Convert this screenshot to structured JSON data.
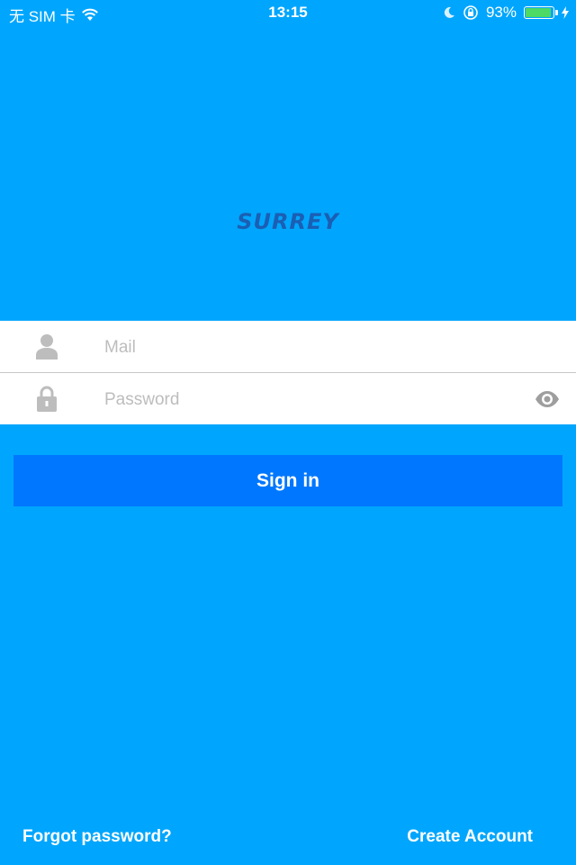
{
  "status_bar": {
    "carrier": "无 SIM 卡",
    "time": "13:15",
    "battery_percent": "93%",
    "battery_level": 0.93,
    "icons": [
      "wifi-icon",
      "moon-icon",
      "orientation-lock-icon",
      "battery-icon",
      "charging-bolt-icon"
    ]
  },
  "logo": {
    "text": "SURREY",
    "color": "#1a5fb4"
  },
  "form": {
    "mail_placeholder": "Mail",
    "password_placeholder": "Password",
    "mail_value": "",
    "password_value": ""
  },
  "signin_button": {
    "label": "Sign in",
    "color": "#0077ff"
  },
  "links": {
    "forgot_password": "Forgot password?",
    "create_account": "Create Account"
  },
  "colors": {
    "background": "#00a6fd",
    "field_icon": "#bdbdbd",
    "battery_fill": "#4cd964"
  }
}
